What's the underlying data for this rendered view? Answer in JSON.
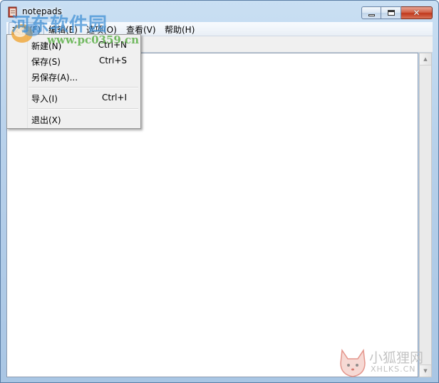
{
  "window": {
    "title": "notepads"
  },
  "menu_bar": {
    "items": [
      {
        "label": "文件(F)"
      },
      {
        "label": "编辑(E)"
      },
      {
        "label": "选项(O)"
      },
      {
        "label": "查看(V)"
      },
      {
        "label": "帮助(H)"
      }
    ]
  },
  "file_menu": {
    "items": [
      {
        "label": "新建(N)",
        "shortcut": "Ctrl+N"
      },
      {
        "label": "保存(S)",
        "shortcut": "Ctrl+S"
      },
      {
        "label": "另保存(A)...",
        "shortcut": ""
      },
      {
        "label": "导入(I)",
        "shortcut": "Ctrl+I"
      },
      {
        "label": "退出(X)",
        "shortcut": ""
      }
    ]
  },
  "editor": {
    "content": ""
  },
  "watermarks": {
    "top_text": "河东软件园",
    "top_url": "www.pc0359.cn",
    "bottom_text": "小狐狸网",
    "bottom_url": "XHLKS.CN"
  },
  "colors": {
    "title_gradient": "#c9dff3",
    "close_button": "#c0391c",
    "menu_bg": "#f0f0f0"
  }
}
